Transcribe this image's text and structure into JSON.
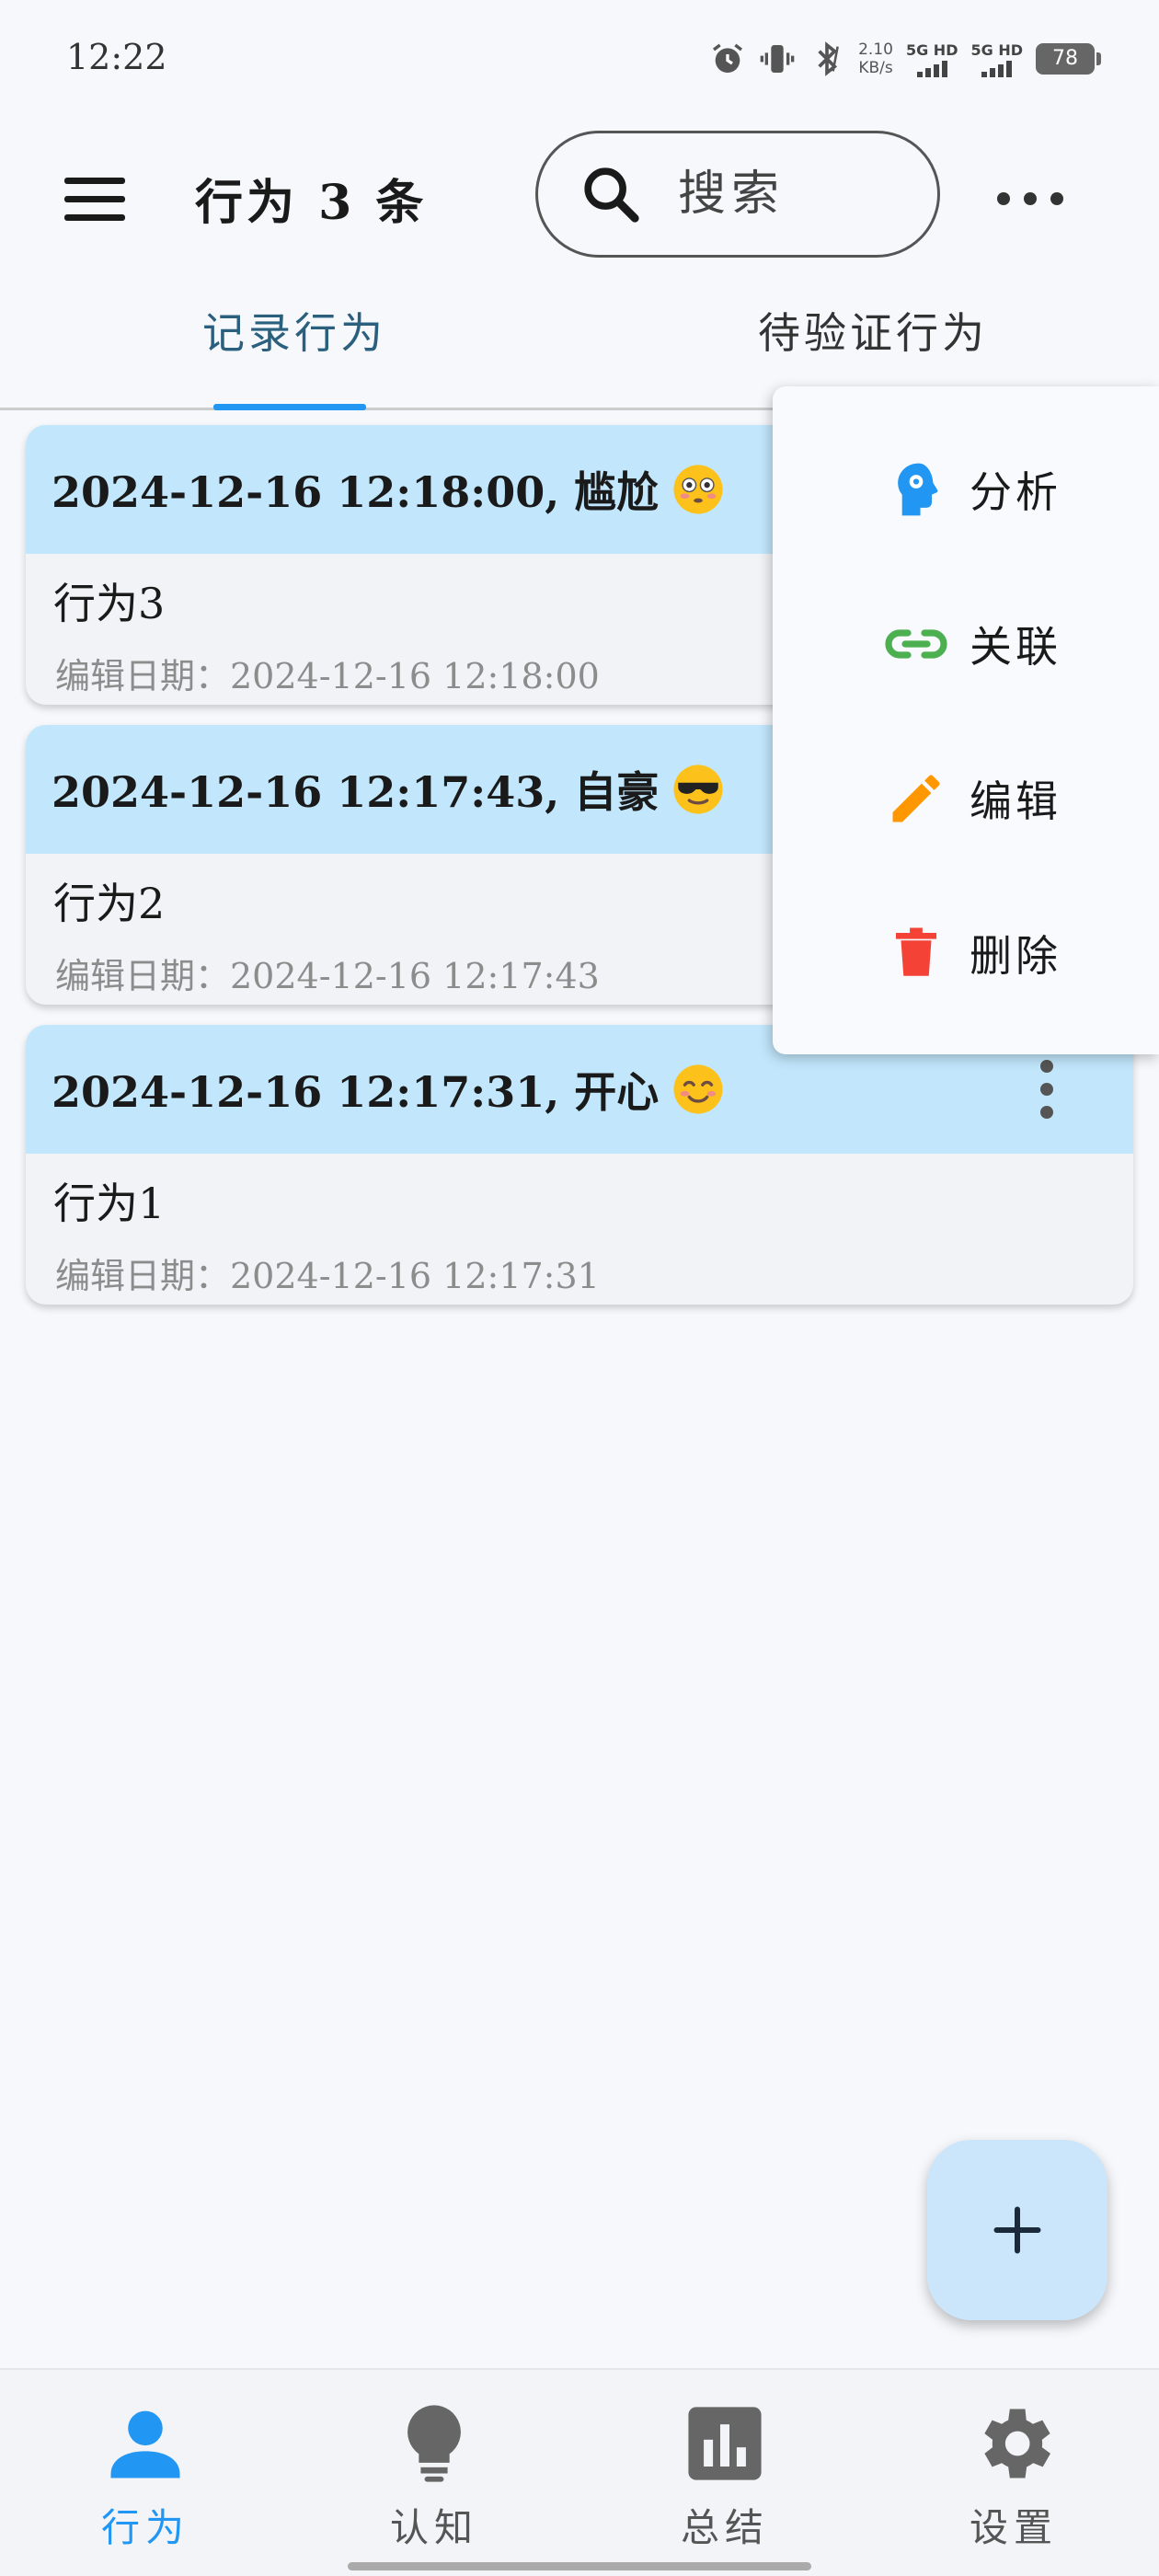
{
  "status_bar": {
    "time": "12:22",
    "net_speed_value": "2.10",
    "net_speed_unit": "KB/s",
    "sim1_label": "5G HD",
    "sim2_label": "5G HD",
    "battery": "78"
  },
  "app_bar": {
    "title": "行为 3 条",
    "search_placeholder": "搜索"
  },
  "tabs": [
    {
      "label": "记录行为",
      "active": true
    },
    {
      "label": "待验证行为",
      "active": false
    }
  ],
  "cards": [
    {
      "header": "2024-12-16 12:18:00, 尴尬",
      "emoji": "flushed-face-icon",
      "content": "行为3",
      "edit_date": "编辑日期：2024-12-16 12:18:00"
    },
    {
      "header": "2024-12-16 12:17:43, 自豪",
      "emoji": "sunglasses-face-icon",
      "content": "行为2",
      "edit_date": "编辑日期：2024-12-16 12:17:43"
    },
    {
      "header": "2024-12-16 12:17:31, 开心",
      "emoji": "smiling-face-icon",
      "content": "行为1",
      "edit_date": "编辑日期：2024-12-16 12:17:31"
    }
  ],
  "popup_menu": [
    {
      "label": "分析",
      "icon": "head-gear-icon",
      "color": "#2196f3"
    },
    {
      "label": "关联",
      "icon": "link-icon",
      "color": "#4caf50"
    },
    {
      "label": "编辑",
      "icon": "pencil-icon",
      "color": "#ff9800"
    },
    {
      "label": "删除",
      "icon": "trash-icon",
      "color": "#f44336"
    }
  ],
  "bottom_nav": [
    {
      "label": "行为",
      "icon": "person-icon",
      "active": true
    },
    {
      "label": "认知",
      "icon": "lightbulb-icon",
      "active": false
    },
    {
      "label": "总结",
      "icon": "bar-chart-icon",
      "active": false
    },
    {
      "label": "设置",
      "icon": "gear-icon",
      "active": false
    }
  ],
  "colors": {
    "accent": "#2196f3",
    "card_header": "#c2e7fc",
    "fab": "#cbe6fb",
    "tab_active_text": "#2a5f7e"
  }
}
